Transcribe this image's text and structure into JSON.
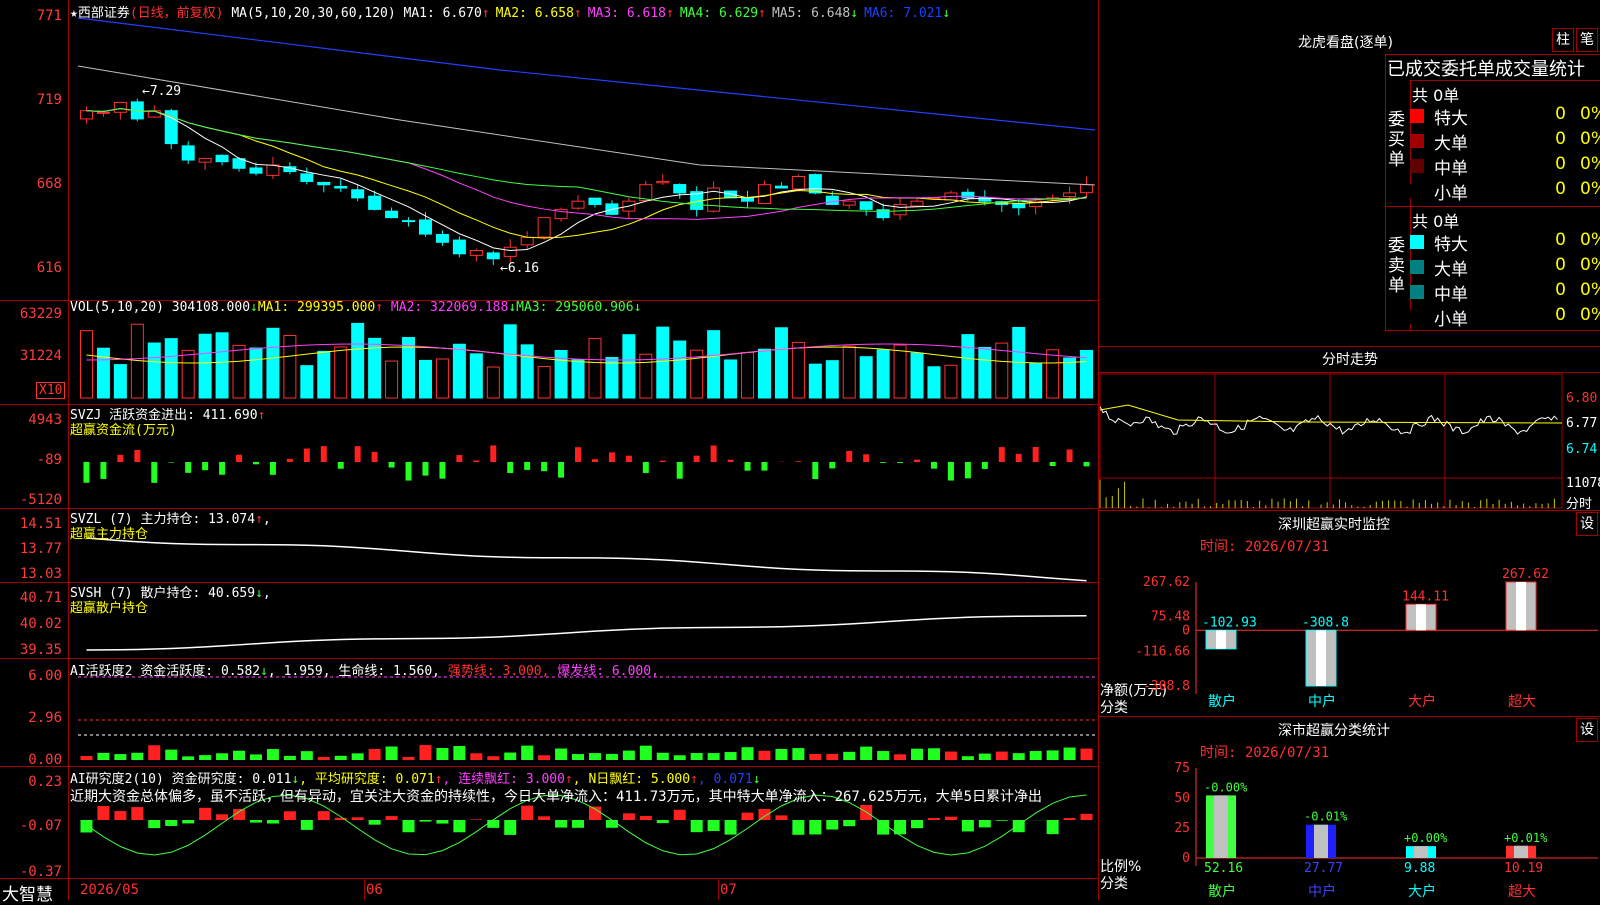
{
  "stock": {
    "name": "★西部证券",
    "mode": "(日线，前复权)",
    "ma_label": "MA(5,10,20,30,60,120)"
  },
  "price_panel": {
    "ma_values": [
      {
        "label": "MA1: 6.670",
        "arrow": "↑",
        "color": "#ffffff"
      },
      {
        "label": "MA2: 6.658",
        "arrow": "↑",
        "color": "#ffff00"
      },
      {
        "label": "MA3: 6.618",
        "arrow": "↑",
        "color": "#ff40ff"
      },
      {
        "label": "MA4: 6.629",
        "arrow": "↑",
        "color": "#40ff40"
      },
      {
        "label": "MA5: 6.648",
        "arrow": "↓",
        "color": "#c0c0c0"
      },
      {
        "label": "MA6: 7.021",
        "arrow": "↓",
        "color": "#2040ff"
      }
    ],
    "y_ticks": [
      "771",
      "719",
      "668",
      "616"
    ],
    "high_mark": "7.29",
    "low_mark": "6.16",
    "ylim": [
      6.06,
      7.75
    ]
  },
  "vol_panel": {
    "title": "VOL(5,10,20)",
    "value": "304108.000",
    "arrow1": "↓",
    "ma1": "MA1: 299395.000",
    "ma1_arrow": "↑",
    "ma2": "MA2: 322069.188",
    "ma2_arrow": "↓",
    "ma3": "MA3: 295060.906",
    "ma3_arrow": "↓",
    "y_ticks": [
      "63229",
      "31224"
    ],
    "unit": "X10"
  },
  "svzj_panel": {
    "title": "SVZJ  活跃资金进出: 411.690",
    "arrow": "↑",
    "subtitle": "超赢资金流(万元)",
    "y_ticks": [
      "4943",
      "-89",
      "-5120"
    ]
  },
  "svzl_panel": {
    "title": "SVZL (7) 主力持仓: 13.074",
    "arrow": "↑",
    "comma": ",",
    "subtitle": "超赢主力持仓",
    "y_ticks": [
      "14.51",
      "13.77",
      "13.03"
    ]
  },
  "svsh_panel": {
    "title": "SVSH (7) 散户持仓: 40.659",
    "arrow": "↓",
    "comma": ",",
    "subtitle": "超赢散户持仓",
    "y_ticks": [
      "40.71",
      "40.02",
      "39.35"
    ]
  },
  "ai2_panel": {
    "title": "AI活跃度2 资金活跃度: 0.582",
    "a1": "↓",
    "v2": ", 1.959,",
    "life": "生命线: 1.560,",
    "strong": "强势线: 3.000,",
    "burst": "爆发线: 6.000,",
    "y_ticks": [
      "6.00",
      "2.96",
      "0.00"
    ]
  },
  "ai3_panel": {
    "title": "AI研究度2(10) 资金研究度: 0.011",
    "a1": "↓",
    "avg": ", 平均研究度: 0.071",
    "a2": "↑",
    "lianxu": ", 连续飘红: 3.000",
    "a3": "↑",
    "nri": ", N日飘红: 5.000",
    "a4": "↑",
    "last": ", 0.071",
    "a5": "↓",
    "comment": "近期大资金总体偏多，虽不活跃，但有异动，宜关注大资金的持续性，今日大单净流入：411.73万元，其中特大单净流入：267.625万元，大单5日累计净出",
    "y_ticks": [
      "0.23",
      "-0.07",
      "-0.37"
    ]
  },
  "x_axis": {
    "labels": [
      "2026/05",
      "06",
      "07"
    ],
    "brand": "大智慧"
  },
  "right_panel": {
    "lhb_title": "龙虎看盘(逐单)",
    "btn1": "柱",
    "btn2": "笔",
    "order_header": "已成交委托单成交量统计",
    "buy": {
      "total": "共 0单",
      "side": "委买单",
      "rows": [
        {
          "name": "特大",
          "vol": "0",
          "pct": "0%",
          "color": "#ff0000"
        },
        {
          "name": "大单",
          "vol": "0",
          "pct": "0%",
          "color": "#a00000"
        },
        {
          "name": "中单",
          "vol": "0",
          "pct": "0%",
          "color": "#600000"
        },
        {
          "name": "小单",
          "vol": "0",
          "pct": "0%",
          "color": "#000000"
        }
      ]
    },
    "sell": {
      "total": "共 0单",
      "side": "委卖单",
      "rows": [
        {
          "name": "特大",
          "vol": "0",
          "pct": "0%",
          "color": "#00ffff"
        },
        {
          "name": "大单",
          "vol": "0",
          "pct": "0%",
          "color": "#008080"
        },
        {
          "name": "中单",
          "vol": "0",
          "pct": "0%",
          "color": "#008080"
        },
        {
          "name": "小单",
          "vol": "0",
          "pct": "0%",
          "color": "#000000"
        }
      ]
    },
    "fenshi": {
      "title": "分时走势",
      "y_ticks": [
        "6.80",
        "6.77",
        "6.74"
      ],
      "vol_label": "11078",
      "vol_unit": "分时"
    },
    "sz_monitor": {
      "title": "深圳超赢实时监控",
      "btn": "设",
      "time": "时间: 2026/07/31",
      "ylabel": "净额(万元)",
      "xlabel": "分类",
      "y_ticks": [
        "267.62",
        "75.48",
        "0",
        "-116.66",
        "-308.8"
      ]
    },
    "sz_class": {
      "title": "深市超赢分类统计",
      "btn": "设",
      "time": "时间: 2026/07/31",
      "ylabel": "比例%",
      "xlabel": "分类",
      "y_ticks": [
        "75",
        "50",
        "25",
        "0"
      ]
    }
  },
  "chart_data": [
    {
      "type": "bar",
      "title": "深圳超赢实时监控",
      "categories": [
        "散户",
        "中户",
        "大户",
        "超大"
      ],
      "values": [
        -102.93,
        -308.8,
        144.11,
        267.62
      ],
      "value_labels": [
        "-102.93",
        "-308.8",
        "144.11",
        "267.62"
      ],
      "ylabel": "净额(万元)",
      "xlabel": "分类",
      "ylim": [
        -308.8,
        267.62
      ]
    },
    {
      "type": "bar",
      "title": "深市超赢分类统计",
      "categories": [
        "散户",
        "中户",
        "大户",
        "超大"
      ],
      "values": [
        52.16,
        27.77,
        9.88,
        10.19
      ],
      "value_labels": [
        "52.16",
        "27.77",
        "9.88",
        "10.19"
      ],
      "changes": [
        "-0.00%",
        "-0.01%",
        "+0.00%",
        "+0.01%"
      ],
      "ylabel": "比例%",
      "xlabel": "分类",
      "ylim": [
        0,
        75
      ]
    }
  ]
}
